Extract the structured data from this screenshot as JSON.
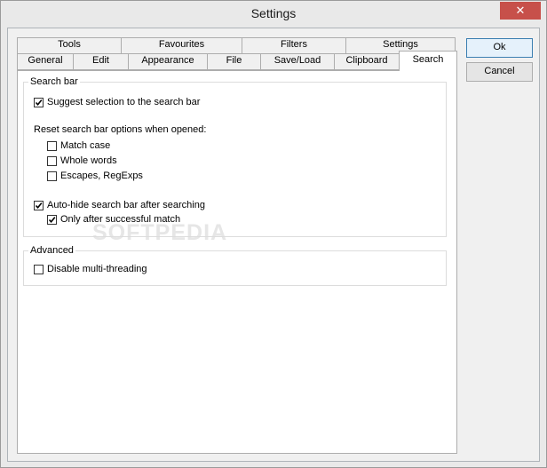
{
  "window": {
    "title": "Settings",
    "close_glyph": "✕"
  },
  "tabs_row1": [
    "Tools",
    "Favourites",
    "Filters",
    "Settings"
  ],
  "tabs_row2": [
    "General",
    "Edit",
    "Appearance",
    "File",
    "Save/Load",
    "Clipboard",
    "Search"
  ],
  "selected_tab": "Search",
  "search_bar_group": {
    "label": "Search bar",
    "suggest_selection": {
      "label": "Suggest selection to the search bar",
      "checked": true
    },
    "reset_label": "Reset search bar options when opened:",
    "match_case": {
      "label": "Match case",
      "checked": false
    },
    "whole_words": {
      "label": "Whole words",
      "checked": false
    },
    "escapes_regexps": {
      "label": "Escapes, RegExps",
      "checked": false
    },
    "auto_hide": {
      "label": "Auto-hide search bar after searching",
      "checked": true
    },
    "only_after_success": {
      "label": "Only after successful match",
      "checked": true
    }
  },
  "advanced_group": {
    "label": "Advanced",
    "disable_multithreading": {
      "label": "Disable multi-threading",
      "checked": false
    }
  },
  "buttons": {
    "ok": "Ok",
    "cancel": "Cancel"
  },
  "watermark": "SOFTPEDIA"
}
